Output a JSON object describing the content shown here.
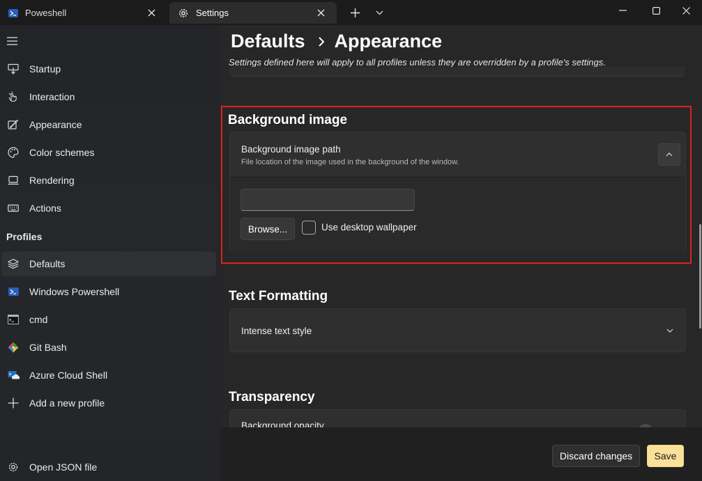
{
  "tabs": [
    {
      "label": "Poweshell",
      "icon": "powershell-icon"
    },
    {
      "label": "Settings",
      "icon": "gear-icon"
    }
  ],
  "sidebar": {
    "items": [
      {
        "label": "Startup",
        "icon": "startup-icon"
      },
      {
        "label": "Interaction",
        "icon": "interaction-icon"
      },
      {
        "label": "Appearance",
        "icon": "appearance-icon"
      },
      {
        "label": "Color schemes",
        "icon": "palette-icon"
      },
      {
        "label": "Rendering",
        "icon": "monitor-icon"
      },
      {
        "label": "Actions",
        "icon": "keyboard-icon"
      }
    ],
    "profiles_header": "Profiles",
    "profiles": [
      {
        "label": "Defaults",
        "icon": "layers-icon",
        "selected": true
      },
      {
        "label": "Windows Powershell",
        "icon": "powershell-icon"
      },
      {
        "label": "cmd",
        "icon": "cmd-icon"
      },
      {
        "label": "Git Bash",
        "icon": "git-icon"
      },
      {
        "label": "Azure Cloud Shell",
        "icon": "azure-cloud-icon"
      },
      {
        "label": "Add a new profile",
        "icon": "plus-icon"
      }
    ],
    "open_json": {
      "label": "Open JSON file",
      "icon": "gear-icon"
    }
  },
  "main": {
    "breadcrumb": [
      "Defaults",
      "Appearance"
    ],
    "subtitle": "Settings defined here will apply to all profiles unless they are overridden by a profile's settings.",
    "background_image": {
      "title": "Background image",
      "path_label": "Background image path",
      "path_desc": "File location of the image used in the background of the window.",
      "path_value": "",
      "browse": "Browse...",
      "wallpaper_label": "Use desktop wallpaper",
      "wallpaper_checked": false
    },
    "text_formatting": {
      "title": "Text Formatting",
      "intense_label": "Intense text style"
    },
    "transparency": {
      "title": "Transparency",
      "opacity_label": "Background opacity"
    }
  },
  "footer": {
    "discard": "Discard changes",
    "save": "Save"
  },
  "colors": {
    "accent_save": "#f9e19a",
    "highlight_border": "#e02020"
  }
}
